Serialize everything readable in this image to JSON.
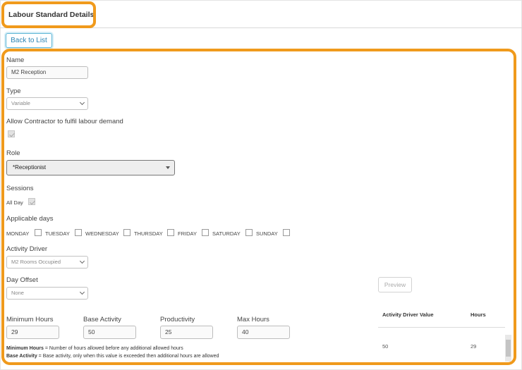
{
  "header": {
    "title": "Labour Standard Details"
  },
  "toolbar": {
    "back_label": "Back to List"
  },
  "form": {
    "name": {
      "label": "Name",
      "value": "M2 Reception"
    },
    "type": {
      "label": "Type",
      "value": "Variable"
    },
    "allow_contractor": {
      "label": "Allow Contractor to fulfil labour demand",
      "checked": true
    },
    "role": {
      "label": "Role",
      "value": "*Receptionist"
    },
    "sessions": {
      "label": "Sessions",
      "all_day_label": "All Day",
      "all_day_checked": true
    },
    "applicable_days": {
      "label": "Applicable days",
      "days": [
        {
          "label": "MONDAY",
          "checked": false
        },
        {
          "label": "TUESDAY",
          "checked": false
        },
        {
          "label": "WEDNESDAY",
          "checked": false
        },
        {
          "label": "THURSDAY",
          "checked": false
        },
        {
          "label": "FRIDAY",
          "checked": false
        },
        {
          "label": "SATURDAY",
          "checked": false
        },
        {
          "label": "SUNDAY",
          "checked": false
        }
      ]
    },
    "activity_driver": {
      "label": "Activity Driver",
      "value": "M2 Rooms Occupied"
    },
    "day_offset": {
      "label": "Day Offset",
      "value": "None"
    },
    "minimum_hours": {
      "label": "Minimum Hours",
      "value": "29"
    },
    "base_activity": {
      "label": "Base Activity",
      "value": "50"
    },
    "productivity": {
      "label": "Productivity",
      "value": "25"
    },
    "max_hours": {
      "label": "Max Hours",
      "value": "40"
    }
  },
  "preview": {
    "button_label": "Preview",
    "columns": [
      "Activity Driver Value",
      "Hours"
    ],
    "rows": [
      [
        "50",
        "29"
      ]
    ]
  },
  "legend": {
    "minimum_hours_term": "Minimum Hours",
    "minimum_hours_text": " = Number of hours allowed before any additional allowed hours",
    "base_activity_term": "Base Activity",
    "base_activity_text": " = Base activity, only when this value is exceeded then additional hours are allowed"
  },
  "colors": {
    "highlight": "#f09a1c",
    "link": "#2a85b5"
  }
}
